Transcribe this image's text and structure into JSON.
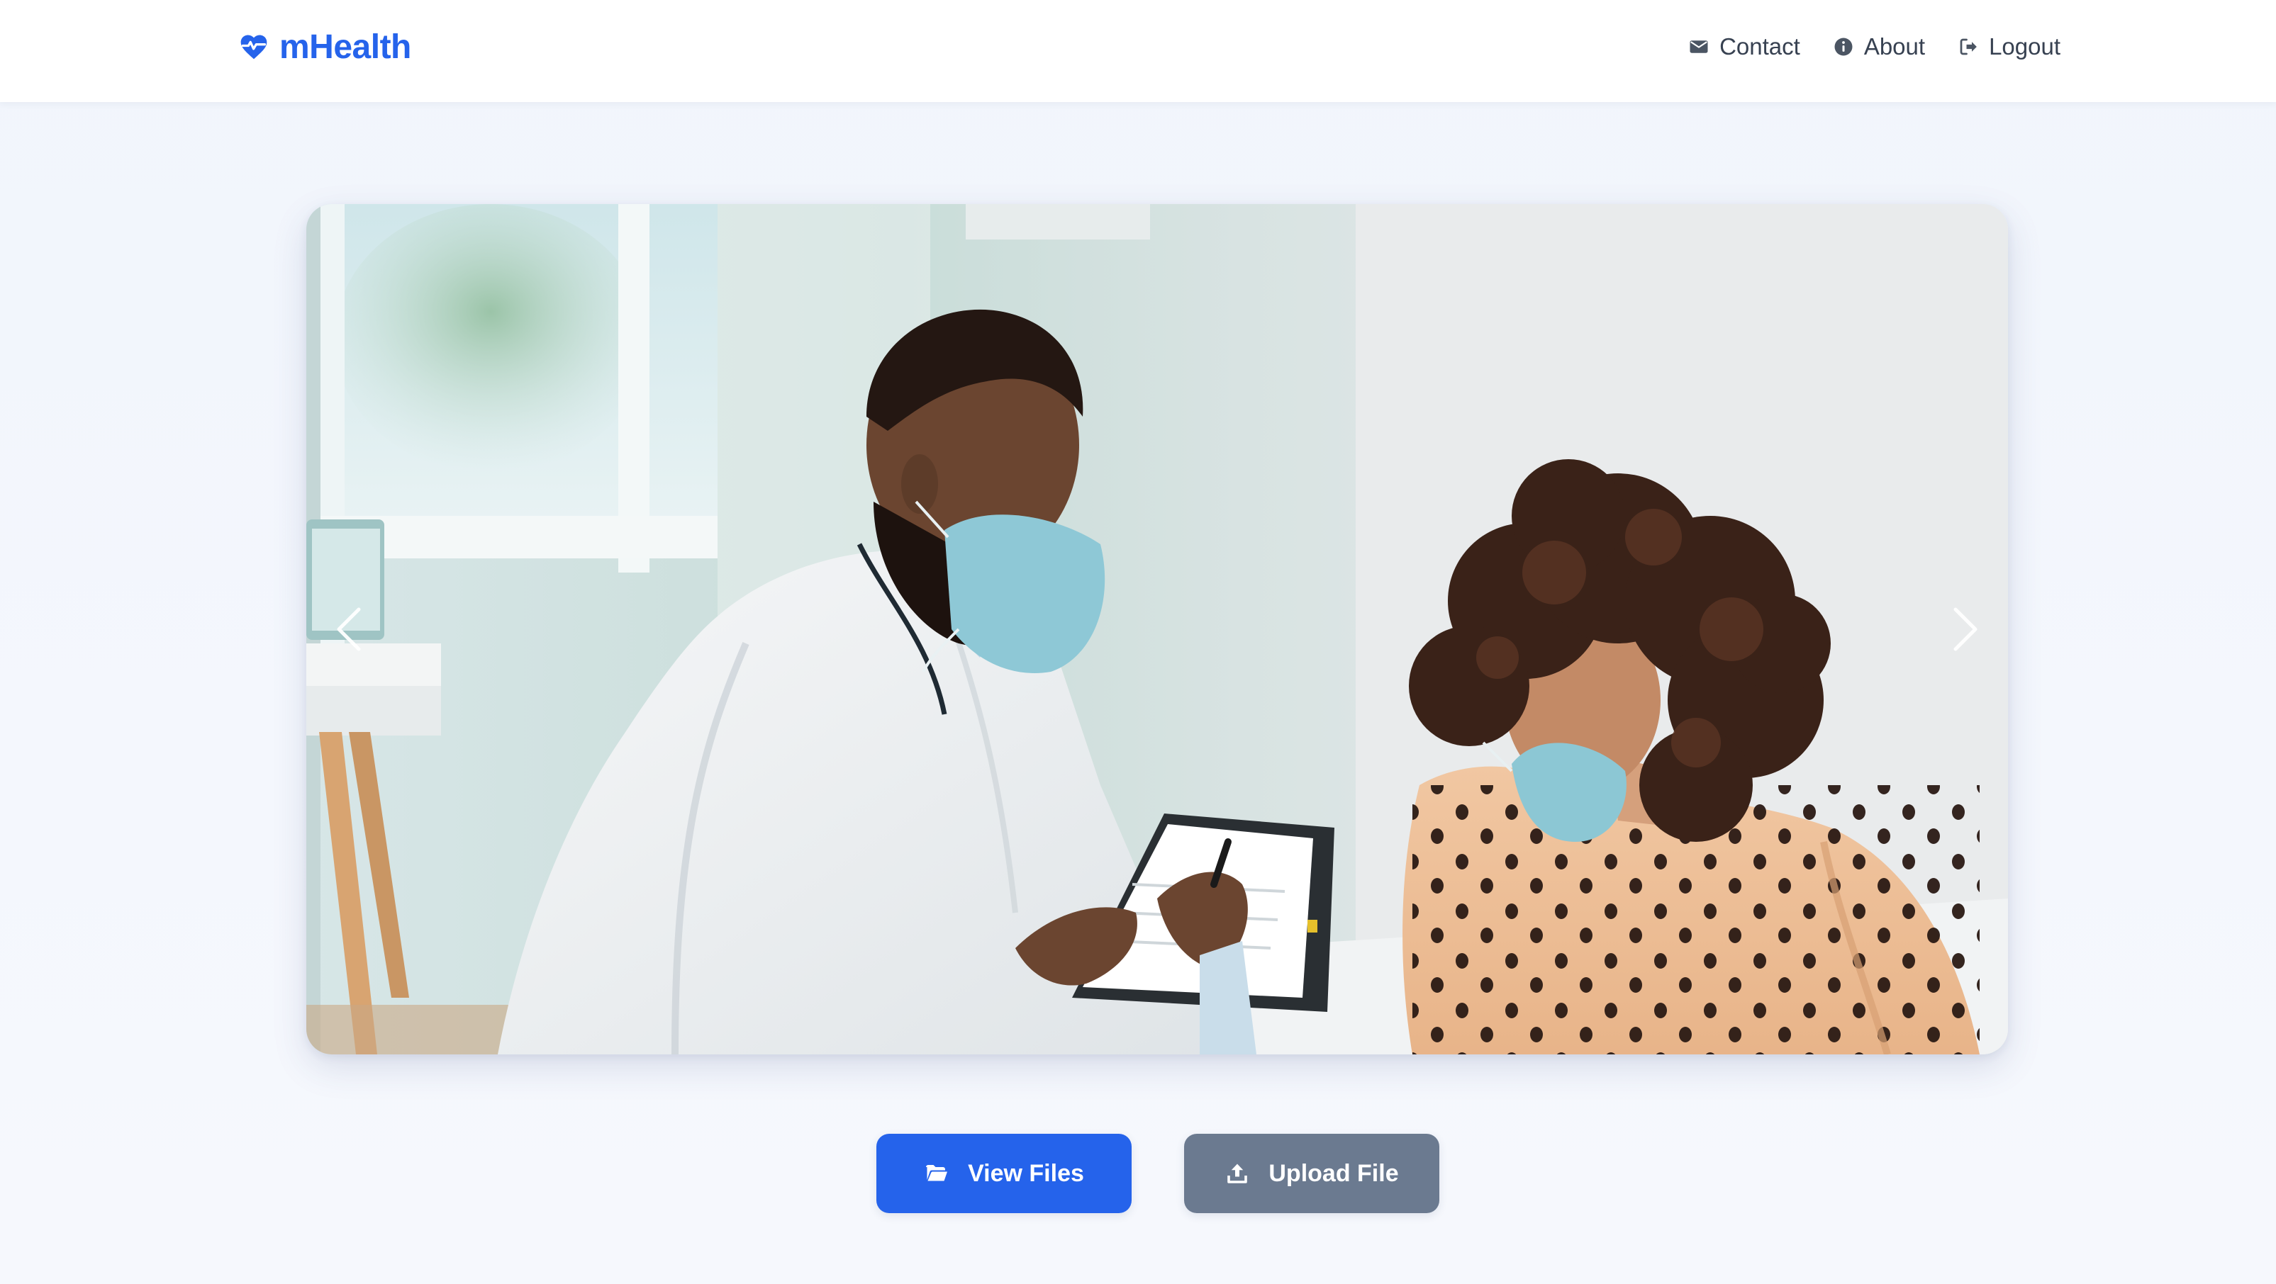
{
  "header": {
    "brand": {
      "name": "mHealth",
      "icon": "heartbeat-icon",
      "color": "#2563eb"
    },
    "nav": [
      {
        "label": "Contact",
        "icon": "envelope-icon"
      },
      {
        "label": "About",
        "icon": "info-circle-icon"
      },
      {
        "label": "Logout",
        "icon": "logout-icon"
      }
    ]
  },
  "carousel": {
    "image": "doctor-consulting-patient-photo",
    "prev_icon": "chevron-left-icon",
    "next_icon": "chevron-right-icon"
  },
  "actions": {
    "view_files": {
      "label": "View Files",
      "icon": "folder-open-icon",
      "color": "#2563eb"
    },
    "upload_file": {
      "label": "Upload File",
      "icon": "upload-icon",
      "color": "#6b7a90"
    }
  }
}
